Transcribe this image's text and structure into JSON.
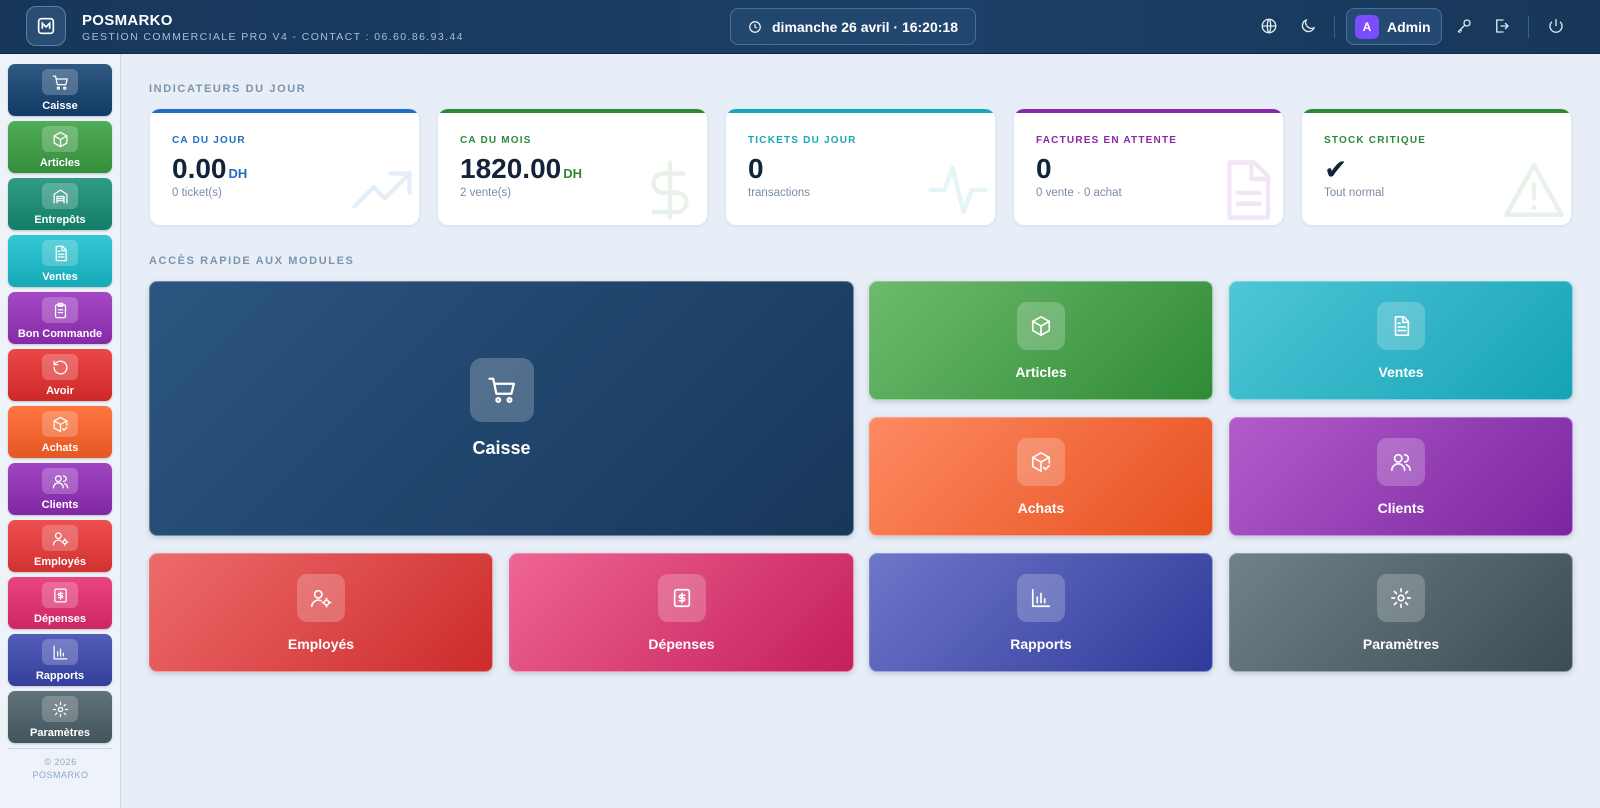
{
  "header": {
    "app_name": "POSMARKO",
    "subtitle": "GESTION COMMERCIALE PRO V4 - CONTACT : 06.60.86.93.44",
    "datetime": "dimanche 26 avril · 16:20:18",
    "user_initial": "A",
    "user_name": "Admin"
  },
  "sidebar": {
    "items": [
      {
        "label": "Caisse",
        "icon": "cart-icon",
        "color": "#1d4670"
      },
      {
        "label": "Articles",
        "icon": "box-icon",
        "color": "#3f9a47"
      },
      {
        "label": "Entrepôts",
        "icon": "warehouse-icon",
        "color": "#1f8a73"
      },
      {
        "label": "Ventes",
        "icon": "document-icon",
        "color": "#22b5c3"
      },
      {
        "label": "Bon Commande",
        "icon": "clipboard-icon",
        "color": "#9236b3"
      },
      {
        "label": "Avoir",
        "icon": "undo-icon",
        "color": "#da3535"
      },
      {
        "label": "Achats",
        "icon": "box-check-icon",
        "color": "#f0632e"
      },
      {
        "label": "Clients",
        "icon": "users-icon",
        "color": "#8e33b0"
      },
      {
        "label": "Employés",
        "icon": "user-gear-icon",
        "color": "#dd3d3d"
      },
      {
        "label": "Dépenses",
        "icon": "receipt-icon",
        "color": "#d8336f"
      },
      {
        "label": "Rapports",
        "icon": "bar-chart-icon",
        "color": "#3f4ba7"
      },
      {
        "label": "Paramètres",
        "icon": "gear-icon",
        "color": "#4e6068"
      }
    ],
    "footer_year": "© 2026",
    "footer_brand": "POSMARKO"
  },
  "indicators": {
    "title": "INDICATEURS DU JOUR",
    "cards": [
      {
        "label": "CA DU JOUR",
        "value": "0.00",
        "unit": "DH",
        "sub": "0 ticket(s)",
        "color": "#1e6fc4"
      },
      {
        "label": "CA DU MOIS",
        "value": "1820.00",
        "unit": "DH",
        "sub": "2 vente(s)",
        "color": "#2e8a3a"
      },
      {
        "label": "TICKETS DU JOUR",
        "value": "0",
        "unit": "",
        "sub": "transactions",
        "color": "#17a7b8"
      },
      {
        "label": "FACTURES EN ATTENTE",
        "value": "0",
        "unit": "",
        "sub": "0 vente · 0 achat",
        "color": "#8a27a8"
      },
      {
        "label": "STOCK CRITIQUE",
        "value": "✔",
        "unit": "",
        "sub": "Tout normal",
        "color": "#2e8a3a"
      }
    ]
  },
  "modules": {
    "title": "ACCÈS RAPIDE AUX MODULES",
    "tiles": [
      {
        "label": "Caisse"
      },
      {
        "label": "Articles"
      },
      {
        "label": "Ventes"
      },
      {
        "label": "Achats"
      },
      {
        "label": "Clients"
      },
      {
        "label": "Employés"
      },
      {
        "label": "Dépenses"
      },
      {
        "label": "Rapports"
      },
      {
        "label": "Paramètres"
      }
    ]
  }
}
